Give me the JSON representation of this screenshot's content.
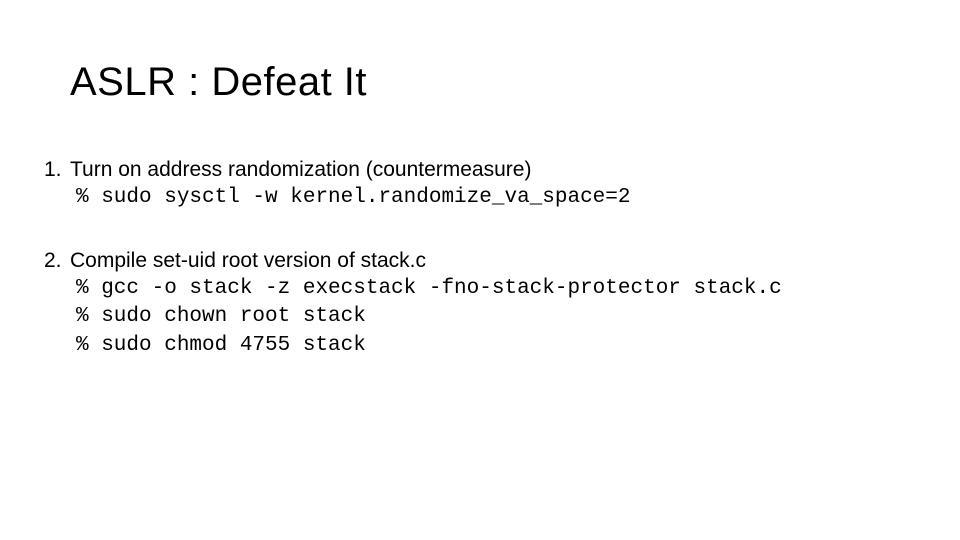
{
  "slide": {
    "title": "ASLR : Defeat It",
    "items": [
      {
        "num": "1.",
        "text": "Turn on address randomization (countermeasure)",
        "commands": [
          "% sudo sysctl -w kernel.randomize_va_space=2"
        ]
      },
      {
        "num": "2.",
        "text": "Compile set-uid root version of stack.c",
        "commands": [
          "% gcc -o stack -z execstack -fno-stack-protector stack.c",
          "% sudo chown root stack",
          "% sudo chmod 4755 stack"
        ]
      }
    ]
  }
}
